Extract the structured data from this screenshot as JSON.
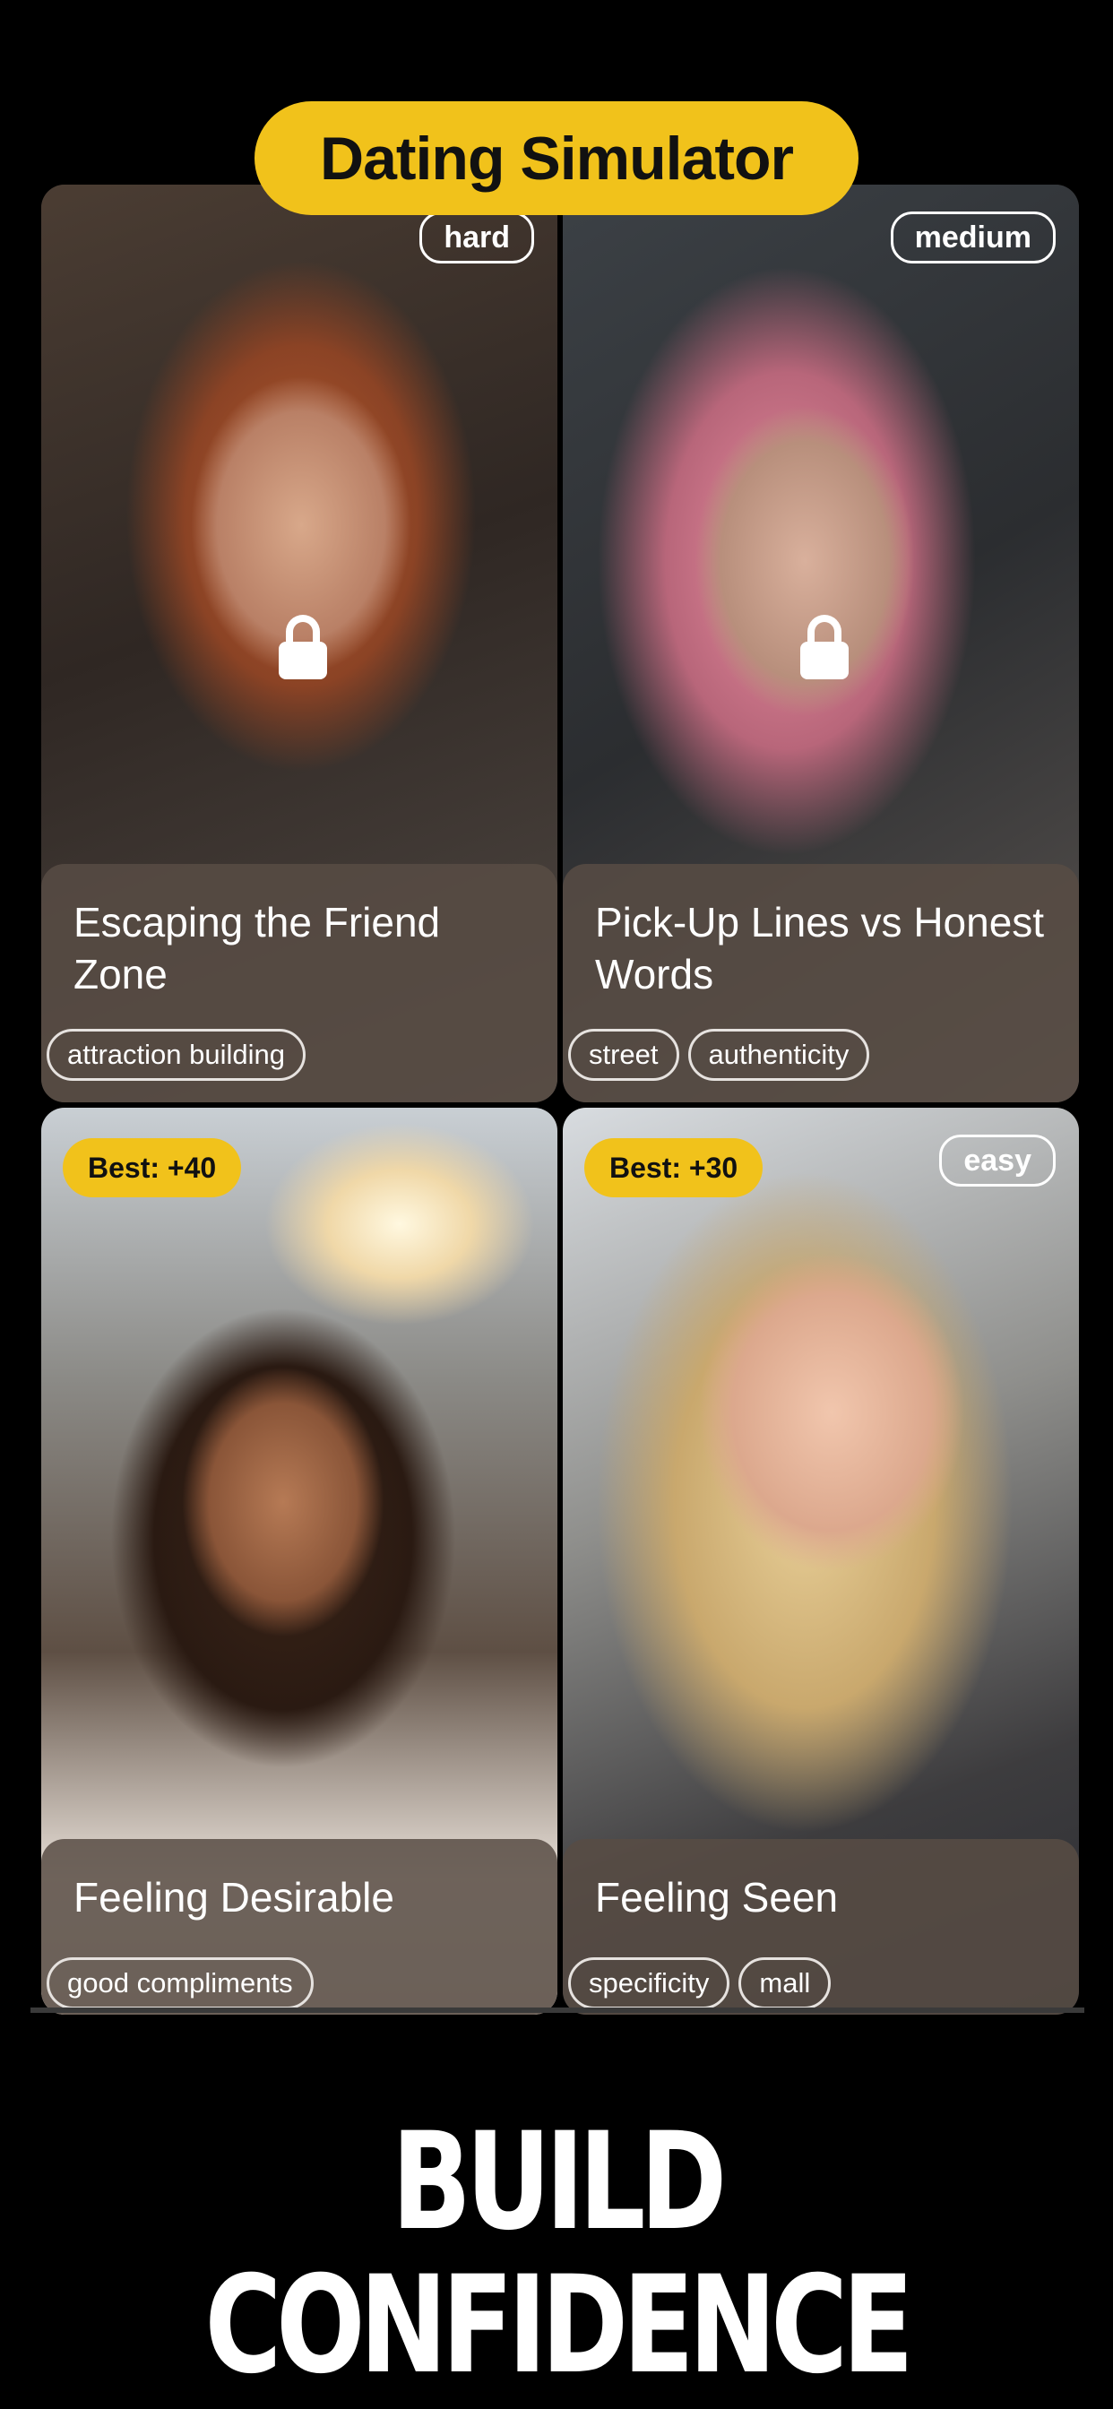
{
  "header": {
    "title": "Dating Simulator"
  },
  "cards": [
    {
      "title": "Escaping the Friend Zone",
      "difficulty": "hard",
      "locked": true,
      "tags": [
        "attraction building"
      ]
    },
    {
      "title": "Pick-Up Lines vs Honest Words",
      "difficulty": "medium",
      "locked": true,
      "tags": [
        "street",
        "authenticity"
      ]
    },
    {
      "title": "Feeling Desirable",
      "best": "Best: +40",
      "locked": false,
      "tags": [
        "good compliments"
      ]
    },
    {
      "title": "Feeling Seen",
      "difficulty": "easy",
      "best": "Best: +30",
      "locked": false,
      "tags": [
        "specificity",
        "mall"
      ]
    }
  ],
  "footer": {
    "slogan": "BUILD CONFIDENCE"
  },
  "colors": {
    "accent": "#f1c21b",
    "background": "#000000"
  },
  "icons": {
    "lock": "lock-icon"
  }
}
